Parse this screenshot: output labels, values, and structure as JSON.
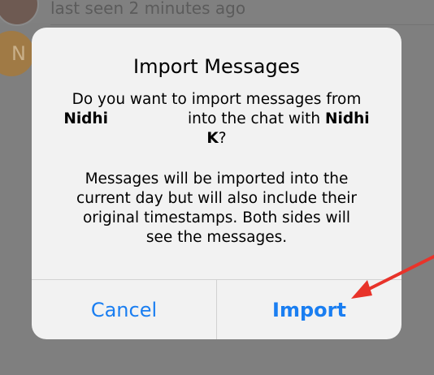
{
  "background": {
    "last_seen": "last seen 2 minutes ago",
    "avatar_initial": "N"
  },
  "alert": {
    "title": "Import Messages",
    "message_line1": "Do you want to import messages from",
    "message_name1": "Nidhi",
    "message_line2_mid": "into the chat with",
    "message_name2_part1": "Nidhi",
    "message_name2_part2": "K",
    "message_q": "?",
    "detail_lines": [
      "Messages will be imported into the",
      "current day but will also include their",
      "original timestamps. Both sides will",
      "see the messages."
    ],
    "cancel_label": "Cancel",
    "import_label": "Import"
  },
  "colors": {
    "accent": "#1a7ef1",
    "annotation_arrow": "#e8332a",
    "dim_background": "#7f7f7f"
  }
}
